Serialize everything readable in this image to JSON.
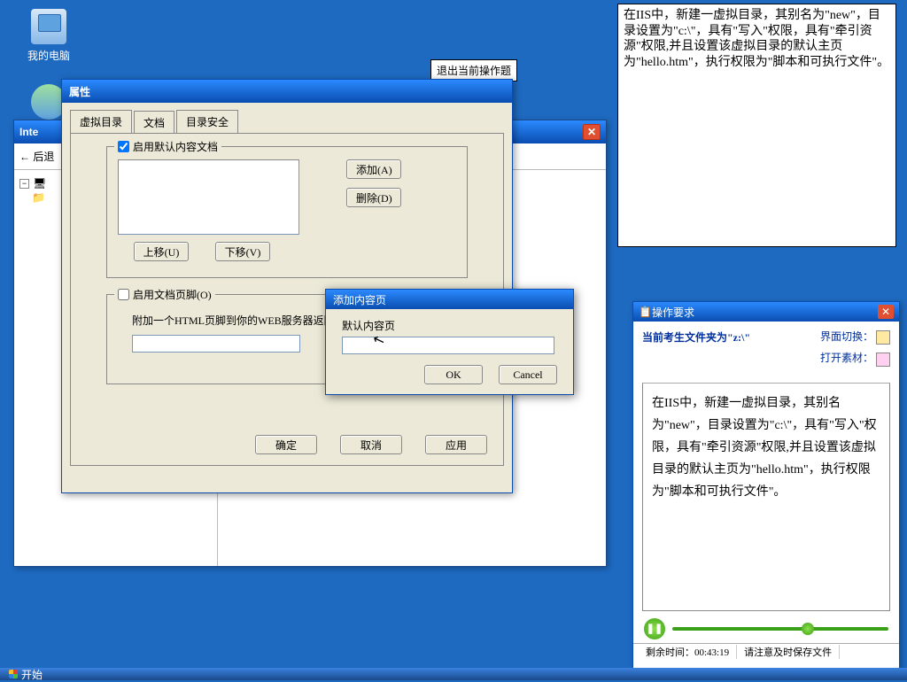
{
  "desktop": {
    "my_computer": "我的电脑"
  },
  "tooltip": "退出当前操作题",
  "iis": {
    "title": "Inte",
    "back": "后退",
    "close": "✕"
  },
  "props": {
    "title": "属性",
    "tabs": {
      "virtual_dir": "虚拟目录",
      "documents": "文档",
      "dir_security": "目录安全"
    },
    "group1_label": "启用默认内容文档",
    "add": "添加(A)",
    "remove": "删除(D)",
    "moveup": "上移(U)",
    "movedown": "下移(V)",
    "group2_label": "启用文档页脚(O)",
    "group2_desc": "附加一个HTML页脚到你的WEB服务器返回",
    "ok": "确定",
    "cancel": "取消",
    "apply": "应用"
  },
  "addpage": {
    "title": "添加内容页",
    "label": "默认内容页",
    "value": "",
    "ok": "OK",
    "cancel": "Cancel"
  },
  "instruction_top": "在IIS中，新建一虚拟目录，其别名为\"new\"，目录设置为\"c:\\\"，具有\"写入\"权限，具有\"牵引资源\"权限,并且设置该虚拟目录的默认主页为\"hello.htm\"，执行权限为\"脚本和可执行文件\"。",
  "req": {
    "title": "操作要求",
    "folder_label": "当前考生文件夹为\"z:\\\"",
    "switch_ui": "界面切换：",
    "open_material": "打开素材：",
    "body": "在IIS中，新建一虚拟目录，其别名为\"new\"，目录设置为\"c:\\\"，具有\"写入\"权限，具有\"牵引资源\"权限,并且设置该虚拟目录的默认主页为\"hello.htm\"，执行权限为\"脚本和可执行文件\"。",
    "time_label": "剩余时间：",
    "time_value": "00:43:19",
    "save_hint": "请注意及时保存文件",
    "close": "✕"
  },
  "taskbar": {
    "start": "开始"
  }
}
